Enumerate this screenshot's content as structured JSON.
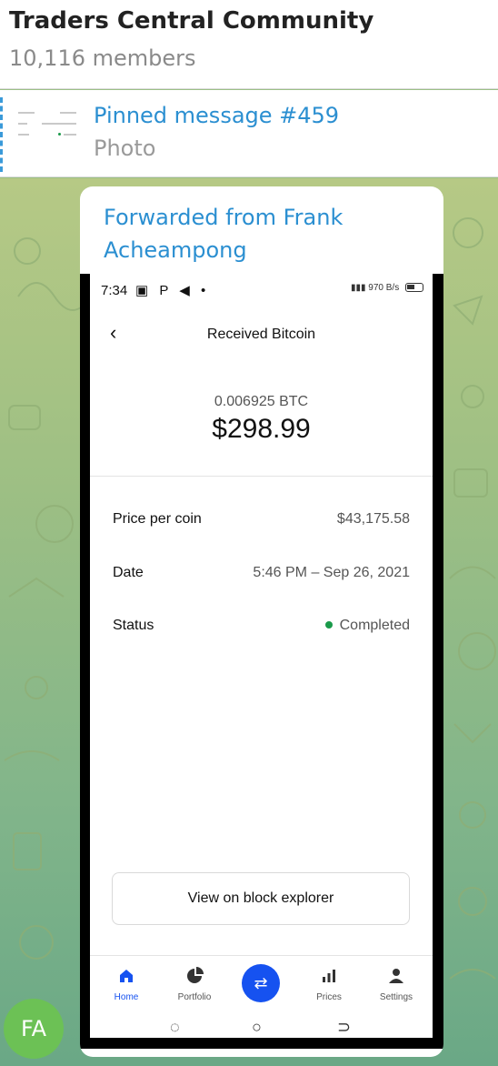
{
  "chat": {
    "title": "Traders Central Community",
    "members": "10,116 members"
  },
  "pinned": {
    "title": "Pinned message #459",
    "subtitle": "Photo"
  },
  "message": {
    "forwarded_from": "Forwarded from Frank Acheampong",
    "sender_initials": "FA"
  },
  "screenshot": {
    "status_bar": {
      "time": "7:34",
      "icons": "▣ P ◀ •",
      "net_speed": "970 B/s"
    },
    "screen_title": "Received Bitcoin",
    "btc_amount": "0.006925 BTC",
    "usd_amount": "$298.99",
    "details": [
      {
        "label": "Price per coin",
        "value": "$43,175.58"
      },
      {
        "label": "Date",
        "value": "5:46 PM – Sep 26, 2021"
      },
      {
        "label": "Status",
        "value": "Completed"
      }
    ],
    "explorer_button": "View on block explorer",
    "nav": [
      {
        "label": "Home",
        "icon": "home-icon",
        "active": true
      },
      {
        "label": "Portfolio",
        "icon": "pie-chart-icon",
        "active": false
      },
      {
        "label": "",
        "icon": "swap-arrows-icon",
        "active": false
      },
      {
        "label": "Prices",
        "icon": "bar-chart-icon",
        "active": false
      },
      {
        "label": "Settings",
        "icon": "person-icon",
        "active": false
      }
    ]
  },
  "colors": {
    "telegram_link_blue": "#2b8fd1",
    "coinbase_blue": "#1652f0",
    "status_green": "#1a9a4a",
    "avatar_green": "#6cc155"
  }
}
